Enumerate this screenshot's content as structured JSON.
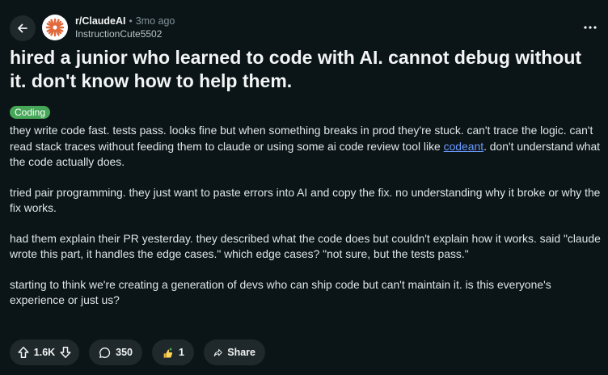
{
  "post": {
    "subreddit": "r/ClaudeAI",
    "separator": "•",
    "time_ago": "3mo ago",
    "author": "InstructionCute5502",
    "title": "hired a junior who learned to code with AI. cannot debug without it. don't know how to help them.",
    "flair": "Coding",
    "flair_color": "#46a758",
    "body": {
      "p1_before": "they write code fast. tests pass. looks fine but when something breaks in prod they're stuck. can't trace the logic. can't read stack traces without feeding them to claude or using some ai code review tool like ",
      "p1_link": "codeant",
      "p1_after": ". don't understand what the code actually does.",
      "p2": "tried pair programming. they just want to paste errors into AI and copy the fix. no understanding why it broke or why the fix works.",
      "p3": "had them explain their PR yesterday. they described what the code does but couldn't explain how it works. said \"claude wrote this part, it handles the edge cases.\" which edge cases? \"not sure, but the tests pass.\"",
      "p4": "starting to think we're creating a generation of devs who can ship code but can't maintain it. is this everyone's experience or just us?"
    }
  },
  "actions": {
    "upvotes": "1.6K",
    "comments": "350",
    "awards": "1",
    "share_label": "Share"
  },
  "icons": {
    "back": "arrow-left-icon",
    "more": "ellipsis-icon",
    "upvote": "arrow-up-icon",
    "downvote": "arrow-down-icon",
    "comment": "speech-bubble-icon",
    "award": "award-hand-icon",
    "share": "share-arrow-icon"
  },
  "colors": {
    "background": "#0b1416",
    "pill": "#1f282a",
    "link": "#6a9bff",
    "avatar_accent": "#e2683a"
  }
}
